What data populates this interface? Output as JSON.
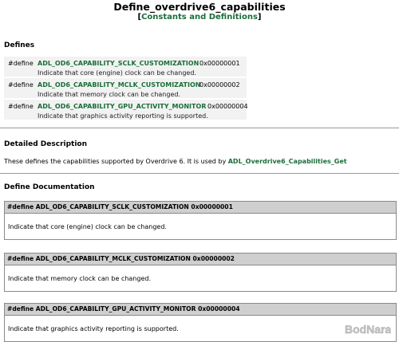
{
  "header": {
    "title": "Define_overdrive6_capabilities",
    "subtitle_open": "[",
    "subtitle_link": "Constants and Definitions",
    "subtitle_close": "]"
  },
  "defines_section": {
    "heading": "Defines",
    "items": [
      {
        "keyword": "#define",
        "name": "ADL_OD6_CAPABILITY_SCLK_CUSTOMIZATION",
        "value": "0x00000001",
        "description": "Indicate that core (engine) clock can be changed."
      },
      {
        "keyword": "#define",
        "name": "ADL_OD6_CAPABILITY_MCLK_CUSTOMIZATION",
        "value": "0x00000002",
        "description": "Indicate that memory clock can be changed."
      },
      {
        "keyword": "#define",
        "name": "ADL_OD6_CAPABILITY_GPU_ACTIVITY_MONITOR",
        "value": "0x00000004",
        "description": "Indicate that graphics activity reporting is supported."
      }
    ]
  },
  "detailed_description": {
    "heading": "Detailed Description",
    "text": "These defines the capabilities supported by Overdrive 6. It is used by ",
    "link": "ADL_Overdrive6_Capabilities_Get"
  },
  "define_documentation": {
    "heading": "Define Documentation",
    "blocks": [
      {
        "signature": "#define ADL_OD6_CAPABILITY_SCLK_CUSTOMIZATION   0x00000001",
        "body": "Indicate that core (engine) clock can be changed."
      },
      {
        "signature": "#define ADL_OD6_CAPABILITY_MCLK_CUSTOMIZATION   0x00000002",
        "body": "Indicate that memory clock can be changed."
      },
      {
        "signature": "#define ADL_OD6_CAPABILITY_GPU_ACTIVITY_MONITOR   0x00000004",
        "body": "Indicate that graphics activity reporting is supported."
      }
    ]
  },
  "watermark": {
    "text": "BodNara"
  }
}
